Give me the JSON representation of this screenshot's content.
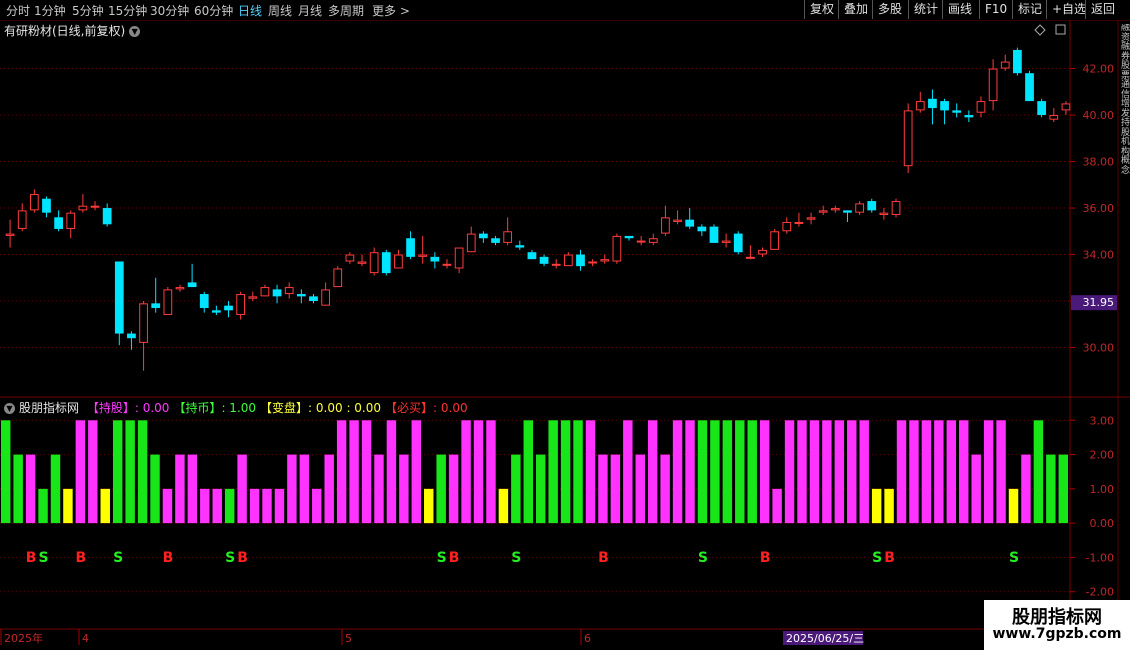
{
  "toolbar": {
    "periods": [
      "分时",
      "1分钟",
      "5分钟",
      "15分钟",
      "30分钟",
      "60分钟",
      "日线",
      "周线",
      "月线",
      "多周期",
      "更多 >"
    ],
    "active_period": "日线",
    "tools": [
      "复权",
      "叠加",
      "多股",
      "统计",
      "画线",
      "F10",
      "标记",
      "+自选",
      "返回"
    ]
  },
  "chart_title": "有研粉材(日线,前复权)",
  "indicator": {
    "name": "股朋指标网",
    "items": [
      {
        "label": "【持股】",
        "value": ": 0.00",
        "color": "#ff39ff"
      },
      {
        "label": "【持币】",
        "value": ": 1.00",
        "color": "#3dff3d"
      },
      {
        "label": "【变盘】",
        "value": ": 0.00 : 0.00",
        "color": "#ffff3d"
      },
      {
        "label": "【必买】",
        "value": ": 0.00",
        "color": "#ff3030"
      }
    ]
  },
  "price_axis": {
    "labels": [
      "42.00",
      "40.00",
      "38.00",
      "36.00",
      "34.00",
      "32.00",
      "30.00"
    ],
    "current_price": "31.95"
  },
  "ind_axis": {
    "labels": [
      "3.00",
      "2.00",
      "1.00",
      "0.00",
      "-1.00",
      "-2.00"
    ]
  },
  "date_axis": {
    "labels": [
      "2025年",
      "4",
      "5",
      "6"
    ],
    "highlight": "2025/06/25/三"
  },
  "right_side_text": "融资融券股票通信增发持股机构概念",
  "watermark": {
    "line1": "股朋指标网",
    "line2": "www.7gpzb.com"
  },
  "colors": {
    "up": "#ff3c3c",
    "down": "#00e5ff",
    "magenta": "#ff33ff",
    "green": "#19e619",
    "yellow": "#ffff00"
  },
  "chart_data": {
    "type": "candlestick",
    "candles": [
      [
        34.8,
        34.9,
        34.3,
        35.5
      ],
      [
        35.1,
        35.9,
        35.0,
        36.2
      ],
      [
        35.9,
        36.6,
        35.8,
        36.8
      ],
      [
        36.4,
        35.8,
        35.6,
        36.5
      ],
      [
        35.6,
        35.1,
        35.0,
        35.9
      ],
      [
        35.1,
        35.8,
        34.7,
        35.9
      ],
      [
        35.9,
        36.1,
        35.8,
        36.6
      ],
      [
        36.1,
        36.1,
        35.9,
        36.3
      ],
      [
        36.0,
        35.3,
        35.2,
        36.2
      ],
      [
        33.7,
        30.6,
        30.1,
        33.7
      ],
      [
        30.6,
        30.4,
        29.9,
        30.7
      ],
      [
        30.2,
        31.9,
        29.0,
        32.0
      ],
      [
        31.9,
        31.7,
        31.5,
        33.0
      ],
      [
        31.4,
        32.5,
        31.4,
        32.6
      ],
      [
        32.5,
        32.6,
        32.4,
        32.7
      ],
      [
        32.8,
        32.6,
        32.6,
        33.6
      ],
      [
        32.3,
        31.7,
        31.5,
        32.4
      ],
      [
        31.6,
        31.5,
        31.4,
        31.8
      ],
      [
        31.8,
        31.6,
        31.3,
        32.0
      ],
      [
        31.4,
        32.3,
        31.2,
        32.4
      ],
      [
        32.1,
        32.2,
        32.0,
        32.4
      ],
      [
        32.2,
        32.6,
        32.2,
        32.7
      ],
      [
        32.5,
        32.2,
        31.9,
        32.7
      ],
      [
        32.3,
        32.6,
        32.1,
        32.8
      ],
      [
        32.3,
        32.2,
        31.9,
        32.5
      ],
      [
        32.2,
        32.0,
        31.9,
        32.3
      ],
      [
        31.8,
        32.5,
        31.8,
        32.8
      ],
      [
        32.6,
        33.4,
        32.6,
        33.5
      ],
      [
        33.7,
        34.0,
        33.6,
        34.1
      ],
      [
        33.6,
        33.7,
        33.5,
        34.0
      ],
      [
        33.2,
        34.1,
        33.1,
        34.3
      ],
      [
        34.1,
        33.2,
        33.1,
        34.2
      ],
      [
        33.4,
        34.0,
        33.4,
        34.2
      ],
      [
        34.7,
        33.9,
        33.8,
        35.0
      ],
      [
        33.9,
        34.0,
        33.6,
        34.8
      ],
      [
        33.9,
        33.7,
        33.4,
        34.1
      ],
      [
        33.6,
        33.6,
        33.4,
        33.8
      ],
      [
        33.4,
        34.3,
        33.2,
        34.3
      ],
      [
        34.1,
        34.9,
        34.1,
        35.2
      ],
      [
        34.9,
        34.7,
        34.5,
        35.0
      ],
      [
        34.7,
        34.5,
        34.4,
        34.8
      ],
      [
        34.5,
        35.0,
        34.4,
        35.6
      ],
      [
        34.4,
        34.3,
        34.2,
        34.6
      ],
      [
        34.1,
        33.8,
        33.8,
        34.2
      ],
      [
        33.9,
        33.6,
        33.5,
        34.0
      ],
      [
        33.6,
        33.6,
        33.4,
        33.8
      ],
      [
        33.5,
        34.0,
        33.5,
        34.1
      ],
      [
        34.0,
        33.5,
        33.3,
        34.2
      ],
      [
        33.7,
        33.7,
        33.5,
        33.8
      ],
      [
        33.7,
        33.8,
        33.6,
        34.0
      ],
      [
        33.7,
        34.8,
        33.6,
        34.9
      ],
      [
        34.8,
        34.7,
        34.6,
        34.8
      ],
      [
        34.6,
        34.6,
        34.4,
        34.8
      ],
      [
        34.5,
        34.7,
        34.4,
        34.9
      ],
      [
        34.9,
        35.6,
        34.8,
        36.1
      ],
      [
        35.4,
        35.5,
        35.3,
        35.9
      ],
      [
        35.5,
        35.2,
        35.1,
        36.0
      ],
      [
        35.2,
        35.0,
        34.8,
        35.3
      ],
      [
        35.2,
        34.5,
        34.5,
        35.3
      ],
      [
        34.5,
        34.6,
        34.3,
        34.9
      ],
      [
        34.9,
        34.1,
        34.0,
        35.0
      ],
      [
        33.9,
        33.9,
        33.8,
        34.4
      ],
      [
        34.0,
        34.2,
        33.9,
        34.3
      ],
      [
        34.2,
        35.0,
        34.2,
        35.1
      ],
      [
        35.0,
        35.4,
        34.9,
        35.6
      ],
      [
        35.4,
        35.4,
        35.2,
        35.8
      ],
      [
        35.5,
        35.6,
        35.3,
        35.8
      ],
      [
        35.8,
        35.9,
        35.7,
        36.1
      ],
      [
        35.9,
        36.0,
        35.8,
        36.1
      ],
      [
        35.9,
        35.8,
        35.4,
        35.9
      ],
      [
        35.8,
        36.2,
        35.7,
        36.3
      ],
      [
        36.3,
        35.9,
        35.8,
        36.4
      ],
      [
        35.7,
        35.8,
        35.5,
        36.0
      ],
      [
        35.7,
        36.3,
        35.6,
        36.4
      ],
      [
        37.8,
        40.2,
        37.5,
        40.5
      ],
      [
        40.2,
        40.6,
        40.1,
        41.0
      ],
      [
        40.7,
        40.3,
        39.6,
        41.1
      ],
      [
        40.6,
        40.2,
        39.6,
        40.7
      ],
      [
        40.2,
        40.1,
        39.9,
        40.5
      ],
      [
        40.0,
        39.9,
        39.7,
        40.2
      ],
      [
        40.1,
        40.6,
        39.9,
        40.8
      ],
      [
        40.6,
        42.0,
        40.2,
        42.4
      ],
      [
        42.0,
        42.3,
        41.9,
        42.6
      ],
      [
        42.8,
        41.8,
        41.7,
        42.9
      ],
      [
        41.8,
        40.6,
        40.6,
        41.9
      ],
      [
        40.6,
        40.0,
        39.9,
        40.7
      ],
      [
        39.8,
        40.0,
        39.7,
        40.3
      ],
      [
        40.2,
        40.5,
        40.0,
        40.6
      ]
    ],
    "indicator_bars": [
      3,
      2,
      2,
      1,
      2,
      1,
      3,
      3,
      1,
      3,
      3,
      3,
      2,
      1,
      2,
      2,
      1,
      1,
      1,
      2,
      1,
      1,
      1,
      2,
      2,
      1,
      2,
      3,
      3,
      3,
      2,
      3,
      2,
      3,
      1,
      2,
      2,
      3,
      3,
      3,
      1,
      2,
      3,
      2,
      3,
      3,
      3,
      3,
      2,
      2,
      3,
      2,
      3,
      2,
      3,
      3,
      3,
      3,
      3,
      3,
      3,
      3,
      1,
      3,
      3,
      3,
      3,
      3,
      3,
      3,
      1,
      1,
      3,
      3,
      3,
      3,
      3,
      3,
      2,
      3,
      3,
      1,
      2,
      3,
      2,
      2
    ],
    "indicator_colors": [
      "g",
      "g",
      "m",
      "g",
      "g",
      "y",
      "m",
      "m",
      "y",
      "g",
      "g",
      "g",
      "g",
      "m",
      "m",
      "m",
      "m",
      "m",
      "g",
      "m",
      "m",
      "m",
      "m",
      "m",
      "m",
      "m",
      "m",
      "m",
      "m",
      "m",
      "m",
      "m",
      "m",
      "m",
      "y",
      "g",
      "m",
      "m",
      "m",
      "m",
      "y",
      "g",
      "g",
      "g",
      "g",
      "g",
      "g",
      "m",
      "m",
      "m",
      "m",
      "m",
      "m",
      "m",
      "m",
      "m",
      "g",
      "g",
      "g",
      "g",
      "g",
      "m",
      "m",
      "m",
      "m",
      "m",
      "m",
      "m",
      "m",
      "m",
      "y",
      "y",
      "m",
      "m",
      "m",
      "m",
      "m",
      "m",
      "m",
      "m",
      "m",
      "y",
      "m",
      "g",
      "g",
      "g"
    ],
    "signals": [
      {
        "index": 2,
        "text": "B"
      },
      {
        "index": 3,
        "text": "S"
      },
      {
        "index": 6,
        "text": "B"
      },
      {
        "index": 9,
        "text": "S"
      },
      {
        "index": 13,
        "text": "B"
      },
      {
        "index": 18,
        "text": "S"
      },
      {
        "index": 19,
        "text": "B"
      },
      {
        "index": 35,
        "text": "S"
      },
      {
        "index": 36,
        "text": "B"
      },
      {
        "index": 41,
        "text": "S"
      },
      {
        "index": 48,
        "text": "B"
      },
      {
        "index": 56,
        "text": "S"
      },
      {
        "index": 61,
        "text": "B"
      },
      {
        "index": 70,
        "text": "S"
      },
      {
        "index": 71,
        "text": "B"
      },
      {
        "index": 81,
        "text": "S"
      }
    ],
    "price_range": [
      28.0,
      43.4
    ],
    "ind_range": [
      -2.3,
      3.3
    ]
  }
}
